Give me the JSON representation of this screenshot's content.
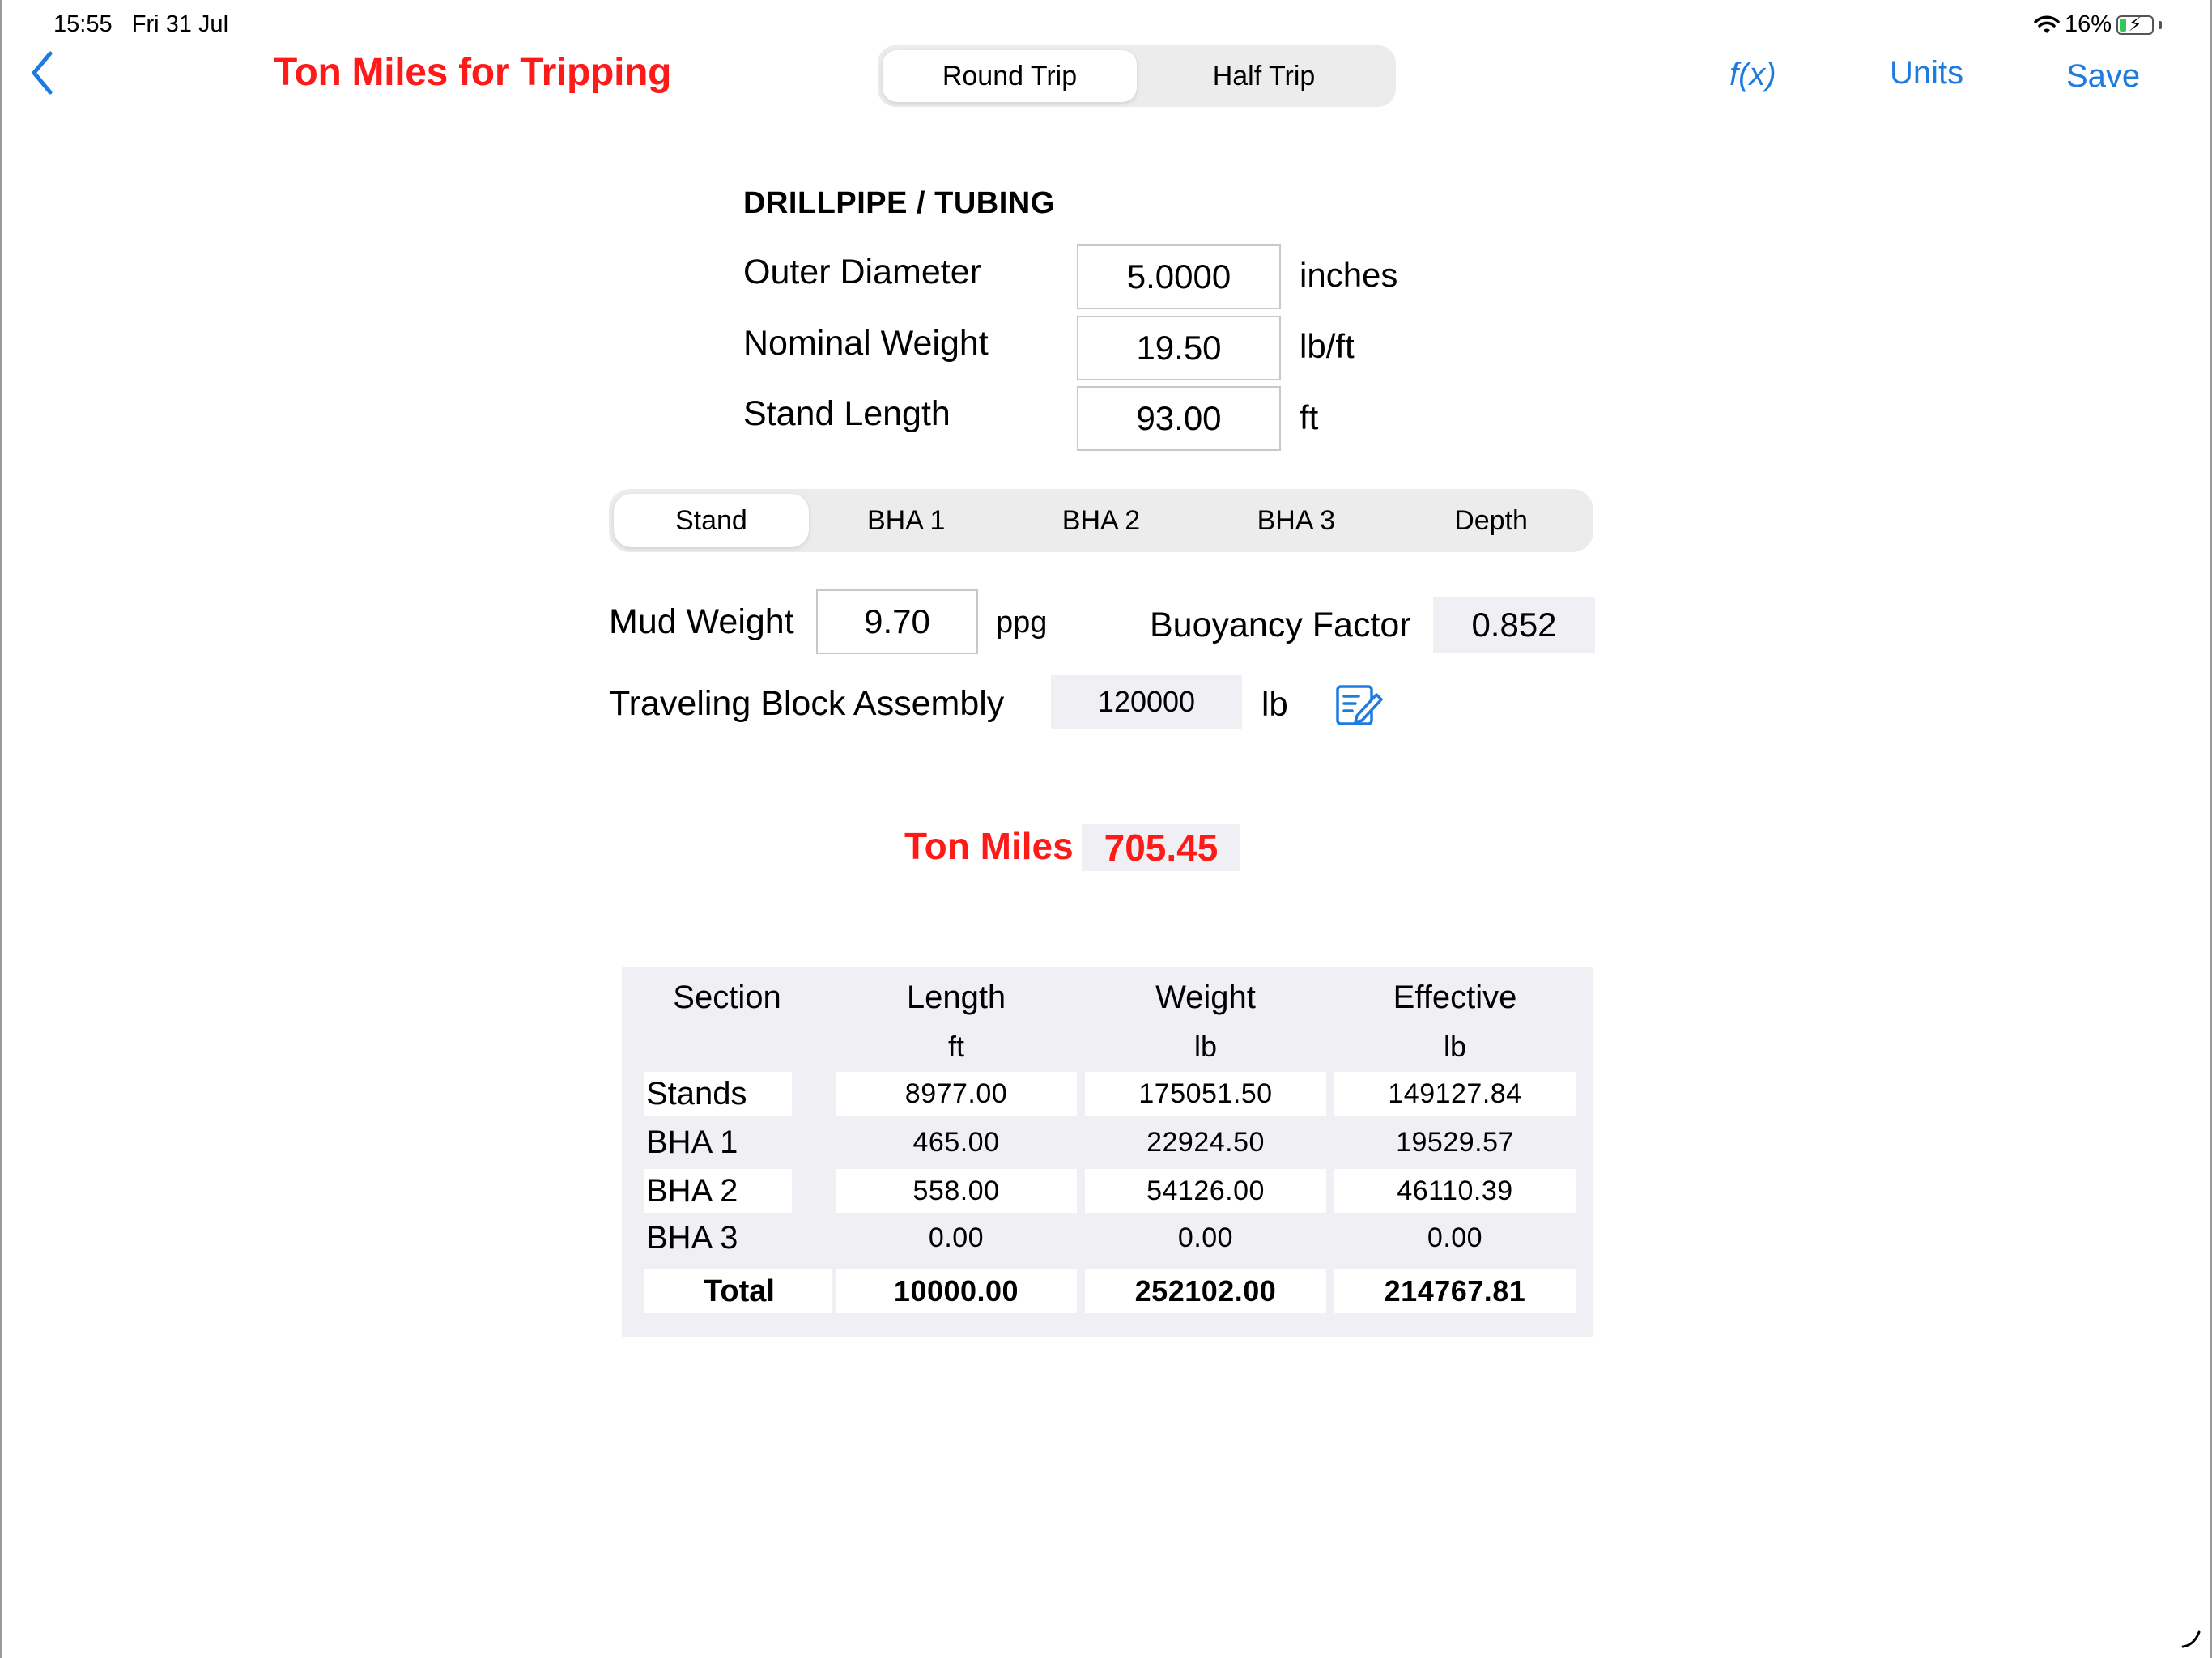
{
  "status_bar": {
    "time": "15:55",
    "date": "Fri 31 Jul",
    "battery": "16%"
  },
  "nav": {
    "title": "Ton Miles for Tripping",
    "trip_tabs": [
      {
        "label": "Round Trip",
        "active": true
      },
      {
        "label": "Half Trip",
        "active": false
      }
    ],
    "fx_label": "f(x)",
    "units_label": "Units",
    "save_label": "Save"
  },
  "drillpipe": {
    "title": "DRILLPIPE / TUBING",
    "fields": [
      {
        "label": "Outer Diameter",
        "value": "5.0000",
        "unit": "inches"
      },
      {
        "label": "Nominal Weight",
        "value": "19.50",
        "unit": "lb/ft"
      },
      {
        "label": "Stand Length",
        "value": "93.00",
        "unit": "ft"
      }
    ]
  },
  "section_tabs": [
    {
      "label": "Stand",
      "active": true
    },
    {
      "label": "BHA 1",
      "active": false
    },
    {
      "label": "BHA 2",
      "active": false
    },
    {
      "label": "BHA 3",
      "active": false
    },
    {
      "label": "Depth",
      "active": false
    }
  ],
  "mud": {
    "label": "Mud Weight",
    "value": "9.70",
    "unit": "ppg"
  },
  "buoyancy": {
    "label": "Buoyancy Factor",
    "value": "0.852"
  },
  "block": {
    "label": "Traveling Block Assembly",
    "value": "120000",
    "unit": "lb"
  },
  "result": {
    "label": "Ton Miles",
    "value": "705.45"
  },
  "table": {
    "headers": [
      {
        "title": "Section",
        "unit": ""
      },
      {
        "title": "Length",
        "unit": "ft"
      },
      {
        "title": "Weight",
        "unit": "lb"
      },
      {
        "title": "Effective",
        "unit": "lb"
      }
    ],
    "rows": [
      {
        "section": "Stands",
        "length": "8977.00",
        "weight": "175051.50",
        "effective": "149127.84"
      },
      {
        "section": "BHA 1",
        "length": "465.00",
        "weight": "22924.50",
        "effective": "19529.57"
      },
      {
        "section": "BHA 2",
        "length": "558.00",
        "weight": "54126.00",
        "effective": "46110.39"
      },
      {
        "section": "BHA 3",
        "length": "0.00",
        "weight": "0.00",
        "effective": "0.00"
      }
    ],
    "total": {
      "section": "Total",
      "length": "10000.00",
      "weight": "252102.00",
      "effective": "214767.81"
    }
  },
  "colors": {
    "accent": "#1e7be0",
    "title_red": "#ff1a1a",
    "readonly_bg": "#f0f0f4"
  }
}
